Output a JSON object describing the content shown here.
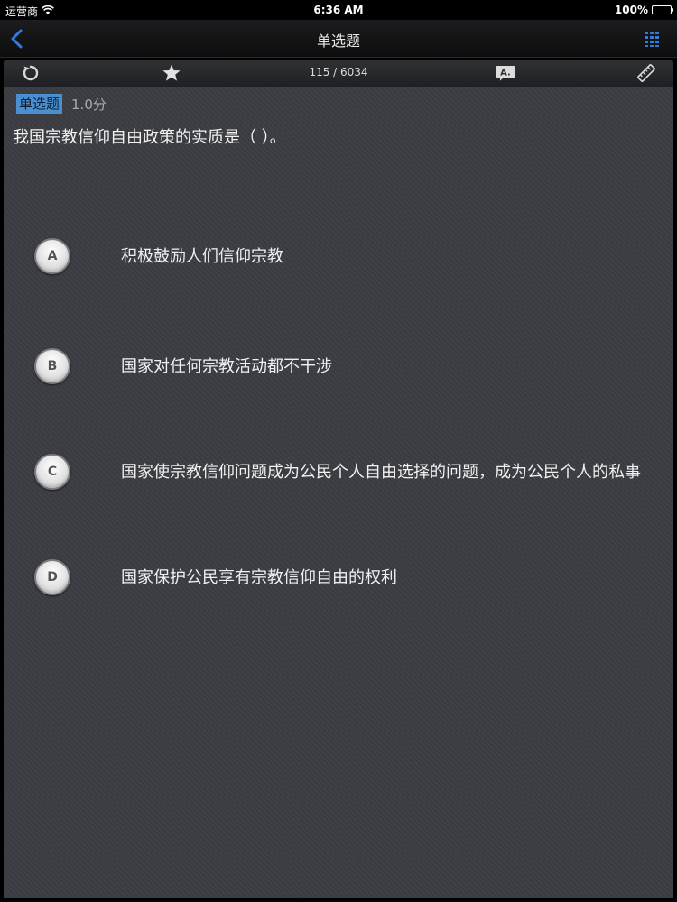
{
  "status_bar": {
    "carrier": "运营商",
    "time": "6:36 AM",
    "battery_text": "100%",
    "battery_level": 1.0
  },
  "nav": {
    "title": "单选题",
    "back_icon": "chevron-left-icon",
    "menu_icon": "grid-icon",
    "accent_color": "#2f7ce0"
  },
  "toolbar": {
    "progress": "115 / 6034",
    "icons": [
      "refresh-icon",
      "star-icon",
      "answer-icon",
      "ruler-icon"
    ]
  },
  "question": {
    "type_label": "单选题",
    "score": "1.0分",
    "text": "我国宗教信仰自由政策的实质是（    ）。",
    "options": [
      {
        "letter": "A",
        "text": "积极鼓励人们信仰宗教"
      },
      {
        "letter": "B",
        "text": "国家对任何宗教活动都不干涉"
      },
      {
        "letter": "C",
        "text": "国家使宗教信仰问题成为公民个人自由选择的问题，成为公民个人的私事"
      },
      {
        "letter": "D",
        "text": "国家保护公民享有宗教信仰自由的权利"
      }
    ]
  },
  "colors": {
    "background": "#3b3d42",
    "type_badge": "#4a90d0"
  }
}
